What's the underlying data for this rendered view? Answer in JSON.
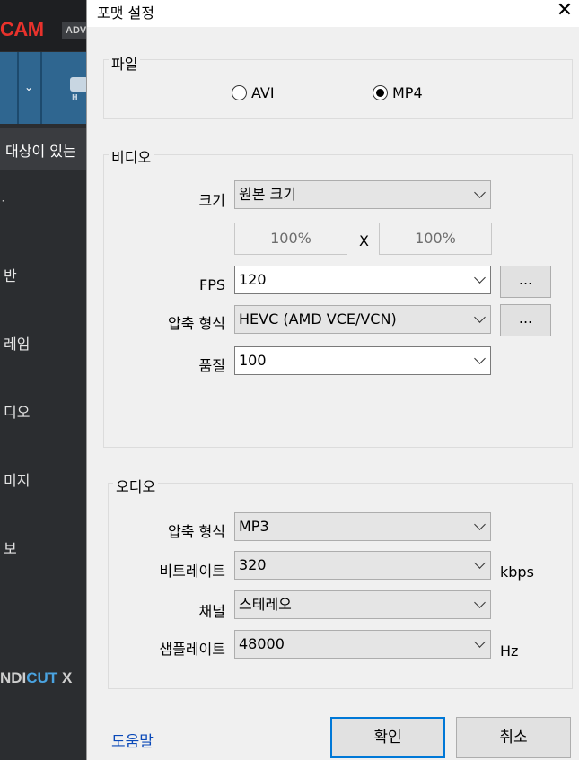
{
  "background_app": {
    "logo": "CAM",
    "badge": "ADV",
    "hd_label": "H",
    "target_text": "대상이 있는",
    "menu": [
      "반",
      "레임",
      "디오",
      "미지",
      "보"
    ],
    "bottom_brand_a": "NDI",
    "bottom_brand_b": "CUT",
    "bottom_brand_tail": "X"
  },
  "dialog": {
    "title": "포맷 설정",
    "close_symbol": "✕"
  },
  "file_group": {
    "label": "파일",
    "options": [
      {
        "label": "AVI",
        "checked": false
      },
      {
        "label": "MP4",
        "checked": true
      }
    ]
  },
  "video_group": {
    "label": "비디오",
    "size_label": "크기",
    "size_value": "원본 크기",
    "width_value": "100%",
    "x_label": "X",
    "height_value": "100%",
    "fps_label": "FPS",
    "fps_value": "120",
    "codec_label": "압축 형식",
    "codec_value": "HEVC (AMD VCE/VCN)",
    "quality_label": "품질",
    "quality_value": "100",
    "more_button": "..."
  },
  "audio_group": {
    "label": "오디오",
    "codec_label": "압축 형식",
    "codec_value": "MP3",
    "bitrate_label": "비트레이트",
    "bitrate_value": "320",
    "bitrate_unit": "kbps",
    "channel_label": "채널",
    "channel_value": "스테레오",
    "samplerate_label": "샘플레이트",
    "samplerate_value": "48000",
    "samplerate_unit": "Hz"
  },
  "footer": {
    "help_label": "도움말",
    "ok_label": "확인",
    "cancel_label": "취소"
  }
}
